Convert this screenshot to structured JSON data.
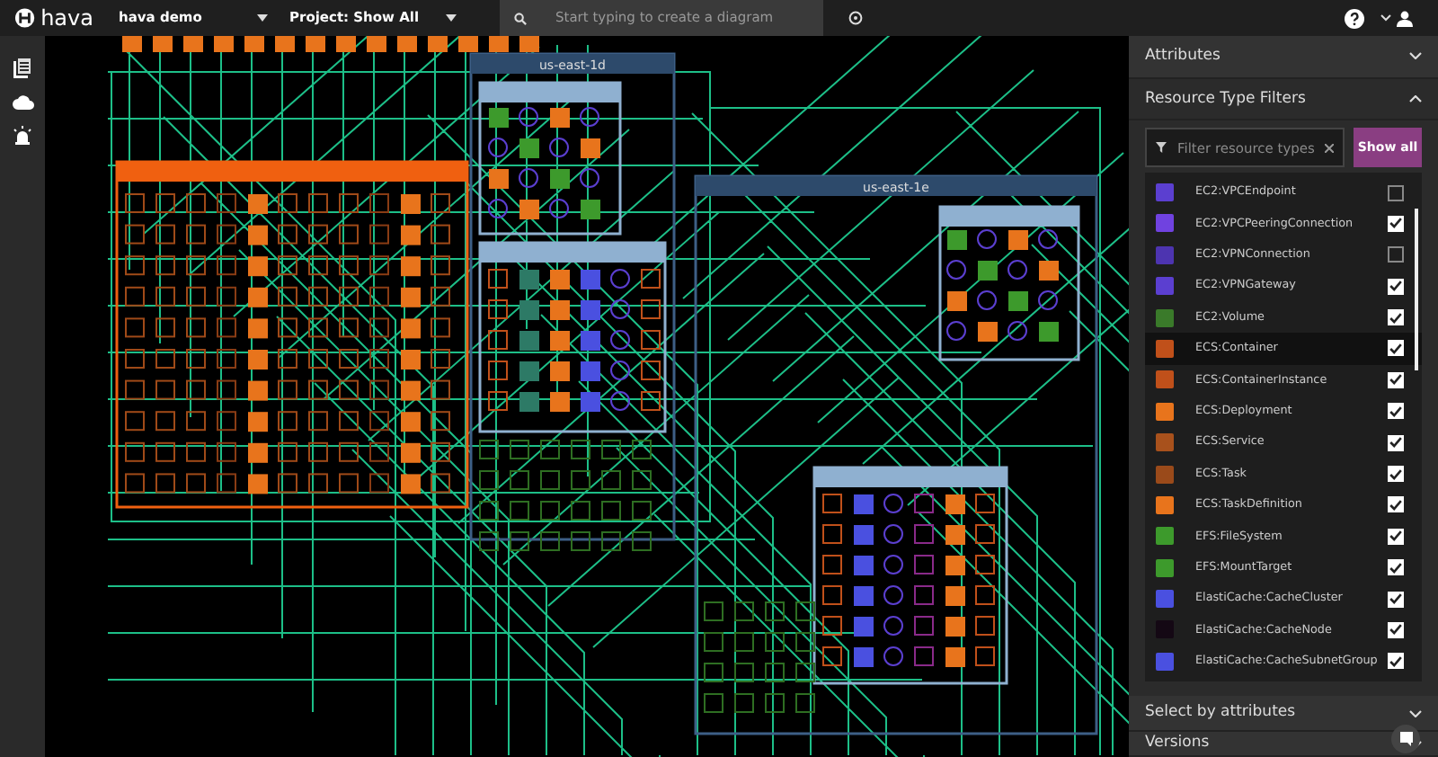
{
  "topbar": {
    "logo": "hava",
    "account": "hava demo",
    "project": "Project: Show All",
    "search": {
      "placeholder": "Start typing to create a diagram"
    }
  },
  "diagram": {
    "regions": [
      {
        "label": "us-east-1d"
      },
      {
        "label": "us-east-1e"
      }
    ]
  },
  "panel": {
    "sections": [
      {
        "title": "Attributes",
        "expanded": false
      },
      {
        "title": "Resource Type Filters",
        "expanded": true
      }
    ],
    "filter": {
      "placeholder": "Filter resource types"
    },
    "show_all": "Show all",
    "items": [
      {
        "label": "EC2:VPCEndpoint",
        "color": "#5b3fd0",
        "checked": false,
        "highlighted": false
      },
      {
        "label": "EC2:VPCPeeringConnection",
        "color": "#7042e0",
        "checked": true,
        "highlighted": false
      },
      {
        "label": "EC2:VPNConnection",
        "color": "#4d34b0",
        "checked": false,
        "highlighted": false
      },
      {
        "label": "EC2:VPNGateway",
        "color": "#5b3fd0",
        "checked": true,
        "highlighted": false
      },
      {
        "label": "EC2:Volume",
        "color": "#3a7a2a",
        "checked": true,
        "highlighted": false
      },
      {
        "label": "ECS:Container",
        "color": "#c0501a",
        "checked": true,
        "highlighted": true
      },
      {
        "label": "ECS:ContainerInstance",
        "color": "#c0501a",
        "checked": true,
        "highlighted": false
      },
      {
        "label": "ECS:Deployment",
        "color": "#e8741c",
        "checked": true,
        "highlighted": false
      },
      {
        "label": "ECS:Service",
        "color": "#a8511c",
        "checked": true,
        "highlighted": false
      },
      {
        "label": "ECS:Task",
        "color": "#9a4a1a",
        "checked": true,
        "highlighted": false
      },
      {
        "label": "ECS:TaskDefinition",
        "color": "#e8741c",
        "checked": true,
        "highlighted": false
      },
      {
        "label": "EFS:FileSystem",
        "color": "#3d9a2c",
        "checked": true,
        "highlighted": false
      },
      {
        "label": "EFS:MountTarget",
        "color": "#3d9a2c",
        "checked": true,
        "highlighted": false
      },
      {
        "label": "ElastiCache:CacheCluster",
        "color": "#4a50e0",
        "checked": true,
        "highlighted": false
      },
      {
        "label": "ElastiCache:CacheNode",
        "color": "#140814",
        "checked": true,
        "highlighted": false
      },
      {
        "label": "ElastiCache:CacheSubnetGroup",
        "color": "#4a50e0",
        "checked": true,
        "highlighted": false
      }
    ],
    "footer_sections": [
      {
        "title": "Select by attributes",
        "expanded": false
      },
      {
        "title": "Versions",
        "expanded": false
      }
    ]
  }
}
